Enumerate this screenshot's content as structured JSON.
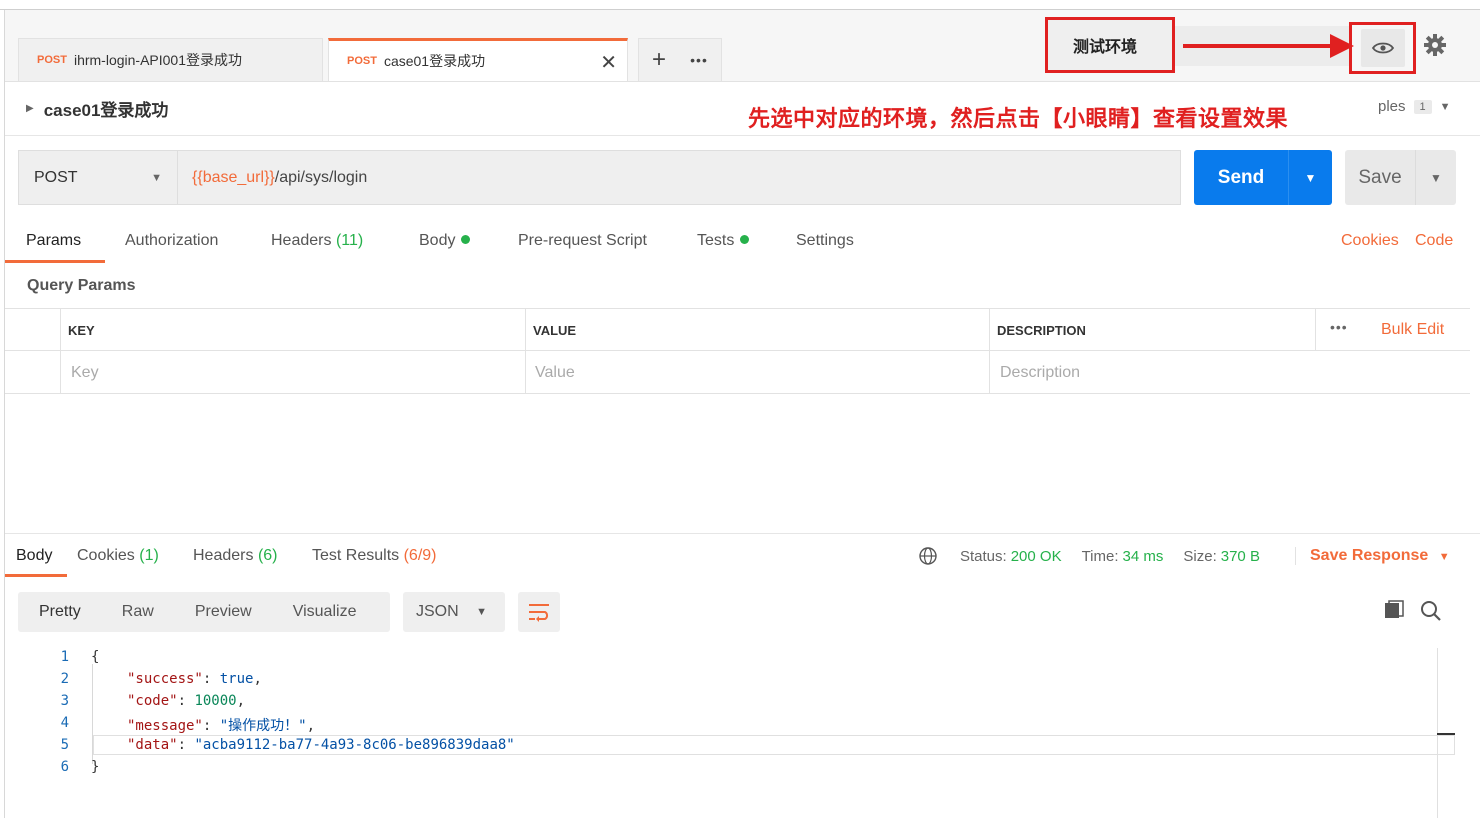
{
  "tabs": [
    {
      "method": "POST",
      "label": "ihrm-login-API001登录成功"
    },
    {
      "method": "POST",
      "label": "case01登录成功",
      "active": true
    }
  ],
  "tab_actions": {
    "new_tab": "+",
    "more": "•••",
    "close": "✕"
  },
  "environment": {
    "selected": "测试环境"
  },
  "breadcrumb": {
    "title": "case01登录成功"
  },
  "annotation": "先选中对应的环境，然后点击【小眼睛】查看设置效果",
  "examples": {
    "label": "ples",
    "count": "1"
  },
  "request": {
    "method": "POST",
    "url_variable": "{{base_url}}",
    "url_path": "/api/sys/login",
    "send_label": "Send",
    "save_label": "Save"
  },
  "request_tabs": {
    "params": "Params",
    "authorization": "Authorization",
    "headers": "Headers",
    "headers_count": "(11)",
    "body": "Body",
    "prerequest": "Pre-request Script",
    "tests": "Tests",
    "settings": "Settings",
    "cookies": "Cookies",
    "code": "Code"
  },
  "query_params": {
    "title": "Query Params",
    "columns": {
      "key": "KEY",
      "value": "VALUE",
      "description": "DESCRIPTION"
    },
    "bulk_edit": "Bulk Edit",
    "more": "•••",
    "placeholders": {
      "key": "Key",
      "value": "Value",
      "description": "Description"
    }
  },
  "response": {
    "tabs": {
      "body": "Body",
      "cookies": "Cookies",
      "cookies_count": "(1)",
      "headers": "Headers",
      "headers_count": "(6)",
      "tests": "Test Results",
      "tests_count": "(6/9)"
    },
    "status_label": "Status:",
    "status_value": "200 OK",
    "time_label": "Time:",
    "time_value": "34 ms",
    "size_label": "Size:",
    "size_value": "370 B",
    "save_response": "Save Response",
    "formats": {
      "pretty": "Pretty",
      "raw": "Raw",
      "preview": "Preview",
      "visualize": "Visualize"
    },
    "language": "JSON",
    "line_numbers": [
      "1",
      "2",
      "3",
      "4",
      "5",
      "6"
    ],
    "json": {
      "open": "{",
      "success_key": "\"success\"",
      "success_val": "true",
      "code_key": "\"code\"",
      "code_val": "10000",
      "message_key": "\"message\"",
      "message_val": "\"操作成功！\"",
      "data_key": "\"data\"",
      "data_val": "\"acba9112-ba77-4a93-8c06-be896839daa8\"",
      "close": "}"
    }
  },
  "colors": {
    "accent": "#f26b3a",
    "send": "#097bed",
    "annotation": "#e02020",
    "ok": "#26b14b"
  }
}
